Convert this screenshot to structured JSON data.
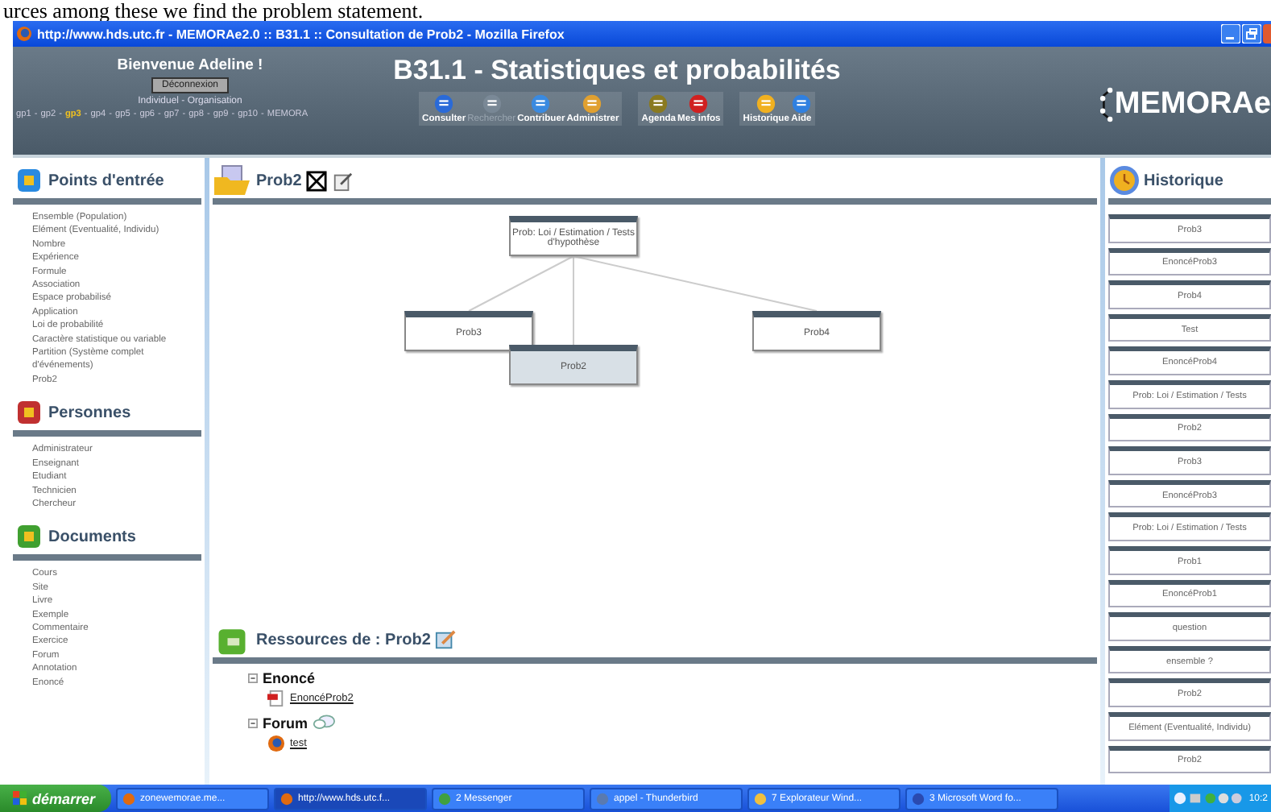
{
  "document_text": "urces among these we find the problem statement.",
  "window": {
    "title": "http://www.hds.utc.fr - MEMORAe2.0 :: B31.1 :: Consultation de Prob2 - Mozilla Firefox"
  },
  "header": {
    "greeting": "Bienvenue Adeline !",
    "logout_button": "Déconnexion",
    "profile": "Individuel - Organisation",
    "groups": [
      {
        "label": "gp1",
        "selected": false
      },
      {
        "label": "gp2",
        "selected": false
      },
      {
        "label": "gp3",
        "selected": true
      },
      {
        "label": "gp4",
        "selected": false
      },
      {
        "label": "gp5",
        "selected": false
      },
      {
        "label": "gp6",
        "selected": false
      },
      {
        "label": "gp7",
        "selected": false
      },
      {
        "label": "gp8",
        "selected": false
      },
      {
        "label": "gp9",
        "selected": false
      },
      {
        "label": "gp10",
        "selected": false
      }
    ],
    "group_separator": "-",
    "groups_tail": "MEMORA",
    "title": "B31.1 - Statistiques et probabilités",
    "toolbar": [
      [
        {
          "label": "Consulter",
          "disabled": false
        },
        {
          "label": "Rechercher",
          "disabled": true
        },
        {
          "label": "Contribuer",
          "disabled": false
        },
        {
          "label": "Administrer",
          "disabled": false
        }
      ],
      [
        {
          "label": "Agenda",
          "disabled": false
        },
        {
          "label": "Mes infos",
          "disabled": false
        }
      ],
      [
        {
          "label": "Historique",
          "disabled": false
        },
        {
          "label": "Aide",
          "disabled": false
        }
      ]
    ],
    "logo": "MEMORAe"
  },
  "sidebar": [
    {
      "title": "Points d'entrée",
      "items": [
        "Ensemble (Population)",
        "Elément (Eventualité, Individu)",
        "Nombre",
        "Expérience",
        "Formule",
        "Association",
        "Espace probabilisé",
        "Application",
        "Loi de probabilité",
        "Caractère statistique ou variable",
        "Partition (Système complet d'événements)",
        "Prob2"
      ]
    },
    {
      "title": "Personnes",
      "items": [
        "Administrateur",
        "Enseignant",
        "Etudiant",
        "Technicien",
        "Chercheur"
      ]
    },
    {
      "title": "Documents",
      "items": [
        "Cours",
        "Site",
        "Livre",
        "Exemple",
        "Commentaire",
        "Exercice",
        "Forum",
        "Annotation",
        "Enoncé"
      ]
    }
  ],
  "panel": {
    "title": "Prob2",
    "nodes": [
      {
        "label": "Prob: Loi / Estimation / Tests d'hypothèse",
        "selected": false
      },
      {
        "label": "Prob3",
        "selected": false
      },
      {
        "label": "Prob4",
        "selected": false
      },
      {
        "label": "Prob2",
        "selected": true
      }
    ]
  },
  "resources": {
    "title": "Ressources de : Prob2",
    "groups": [
      {
        "title": "Enoncé",
        "items": [
          "EnoncéProb2"
        ]
      },
      {
        "title": "Forum",
        "items": [
          "test"
        ]
      }
    ]
  },
  "history": {
    "title": "Historique",
    "items": [
      "Prob3",
      "EnoncéProb3",
      "Prob4",
      "Test",
      "EnoncéProb4",
      "Prob: Loi / Estimation / Tests",
      "Prob2",
      "Prob3",
      "EnoncéProb3",
      "Prob: Loi / Estimation / Tests",
      "Prob1",
      "EnoncéProb1",
      "question",
      "ensemble ?",
      "Prob2",
      "Elément (Eventualité, Individu)",
      "Prob2"
    ]
  },
  "taskbar": {
    "start": "démarrer",
    "tasks": [
      {
        "label": "zonewemorae.me...",
        "selected": false
      },
      {
        "label": "http://www.hds.utc.f...",
        "selected": true
      },
      {
        "label": "2 Messenger",
        "selected": false
      },
      {
        "label": "appel - Thunderbird",
        "selected": false
      },
      {
        "label": "7 Explorateur Wind...",
        "selected": false
      },
      {
        "label": "3 Microsoft Word fo...",
        "selected": false
      }
    ],
    "clock": "10:2"
  }
}
